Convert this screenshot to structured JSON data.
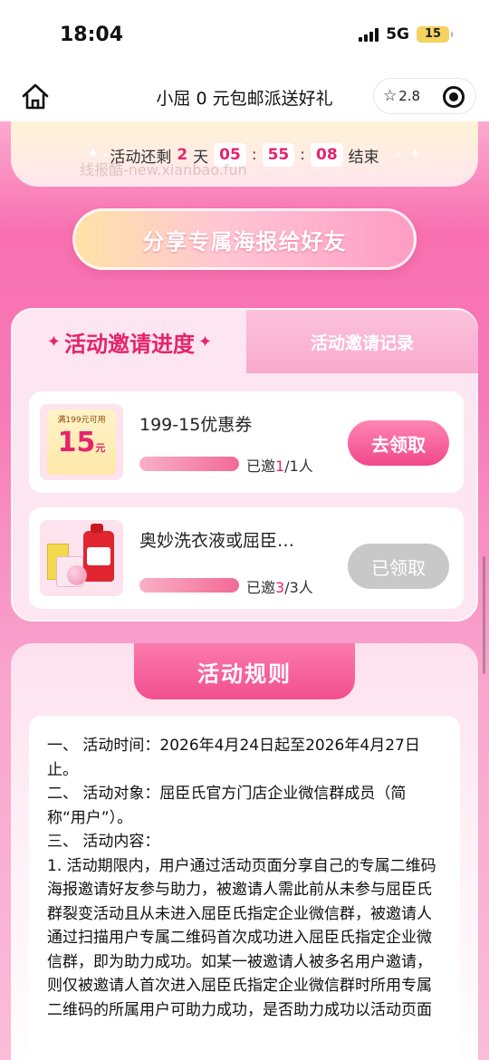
{
  "status_bar": {
    "time": "18:04",
    "network": "5G",
    "battery": "15"
  },
  "nav": {
    "title": "小屈 0 元包邮派送好礼",
    "rating": "2.8",
    "icons": [
      "home-icon",
      "star-icon",
      "target-icon"
    ]
  },
  "countdown": {
    "prefix": "活动还剩",
    "days": "2",
    "day_unit": "天",
    "hours": "05",
    "minutes": "55",
    "seconds": "08",
    "suffix": "结束",
    "watermark": "线报酷-new.xianbao.fun"
  },
  "share_button": "分享专属海报给好友",
  "tabs": {
    "active": "活动邀请进度",
    "inactive": "活动邀请记录"
  },
  "rewards": [
    {
      "title": "199-15优惠券",
      "coupon_condition": "满199元可用",
      "coupon_value": "15",
      "coupon_unit": "元",
      "invited_prefix": "已邀",
      "invited_done": "1",
      "invited_total": "/1人",
      "progress": 1.0,
      "button": "去领取",
      "claimed": false
    },
    {
      "title": "奥妙洗衣液或屈臣…",
      "invited_prefix": "已邀",
      "invited_done": "3",
      "invited_total": "/3人",
      "progress": 1.0,
      "button": "已领取",
      "claimed": true
    }
  ],
  "rules": {
    "title": "活动规则",
    "lines": [
      "一、 活动时间：2026年4月24日起至2026年4月27日止。",
      "二、 活动对象：屈臣氏官方门店企业微信群成员（简称“用户”）。",
      "三、 活动内容：",
      "1. 活动期限内，用户通过活动页面分享自己的专属二维码海报邀请好友参与助力，被邀请人需此前从未参与屈臣氏群裂变活动且从未进入屈臣氏指定企业微信群，被邀请人通过扫描用户专属二维码首次成功进入屈臣氏指定企业微信群，即为助力成功。如某一被邀请人被多名用户邀请，则仅被邀请人首次进入屈臣氏指定企业微信群时所用专属二维码的所属用户可助力成功，是否助力成功以活动页面"
    ]
  },
  "colors": {
    "accent": "#e5246b",
    "pink_bg": "#f870b0",
    "claimed_gray": "#c8c8c8"
  }
}
